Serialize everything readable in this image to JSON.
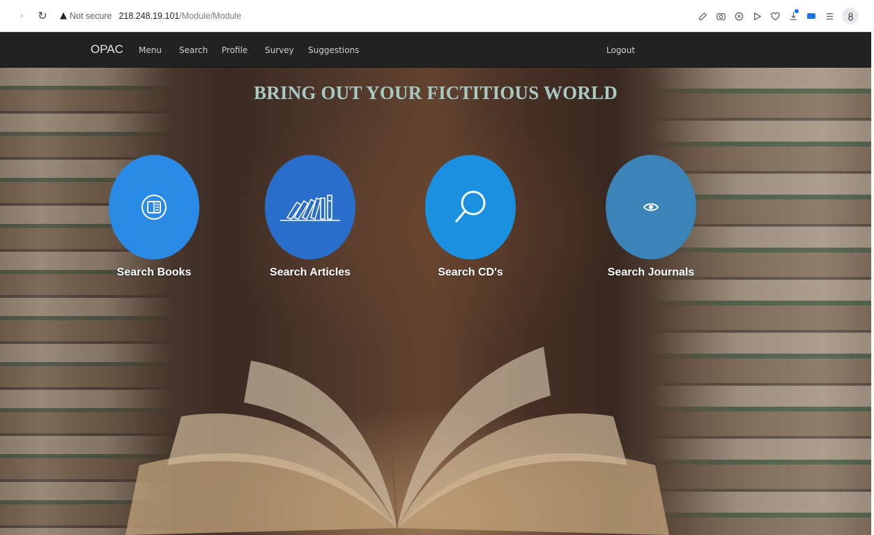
{
  "browser": {
    "security_label": "Not secure",
    "url_host": "218.248.19.101",
    "url_path": "/Module/Module",
    "toolbar_icons": [
      "edit-icon",
      "camera-icon",
      "shield-icon",
      "play-icon",
      "heart-icon",
      "download-icon",
      "extension-icon",
      "menu-lines-icon",
      "profile-icon"
    ],
    "accent": "#1a73e8"
  },
  "navbar": {
    "brand": "OPAC",
    "links": [
      "Menu",
      "Search",
      "Profile",
      "Survey",
      "Suggestions"
    ],
    "logout": "Logout",
    "background": "#222222"
  },
  "hero": {
    "headline": "BRING OUT YOUR FICTITIOUS WORLD",
    "headline_color": "#a9c9c2"
  },
  "tiles": [
    {
      "label": "Search Books",
      "icon": "book-icon",
      "color": "#2a8be6"
    },
    {
      "label": "Search Articles",
      "icon": "books-shelf-icon",
      "color": "#2a6ecb"
    },
    {
      "label": "Search CD's",
      "icon": "search-icon",
      "color": "#1b8fe0"
    },
    {
      "label": "Search Journals",
      "icon": "eye-icon",
      "color": "#3b84b8"
    }
  ]
}
